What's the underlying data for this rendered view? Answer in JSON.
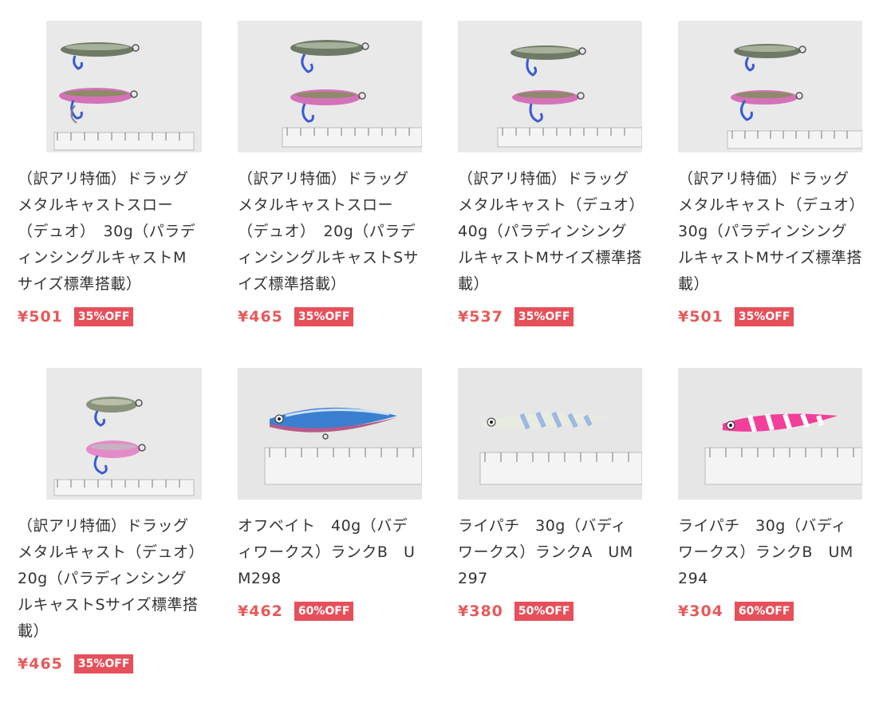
{
  "products": [
    {
      "title": "（訳アリ特価）ドラッグメタルキャストスロー（デュオ）　30g（パラディンシングルキャストMサイズ標準搭載）",
      "price": "¥501",
      "discount": "35%OFF",
      "image_icon": "twin-lure-photo-icon"
    },
    {
      "title": "（訳アリ特価）ドラッグメタルキャストスロー（デュオ）　20g（パラディンシングルキャストSサイズ標準搭載）",
      "price": "¥465",
      "discount": "35%OFF",
      "image_icon": "twin-lure-photo-icon"
    },
    {
      "title": "（訳アリ特価）ドラッグメタルキャスト（デュオ）　40g（パラディンシングルキャストMサイズ標準搭載）",
      "price": "¥537",
      "discount": "35%OFF",
      "image_icon": "twin-lure-photo-icon"
    },
    {
      "title": "（訳アリ特価）ドラッグメタルキャスト（デュオ）　30g（パラディンシングルキャストMサイズ標準搭載）",
      "price": "¥501",
      "discount": "35%OFF",
      "image_icon": "twin-lure-photo-icon"
    },
    {
      "title": "（訳アリ特価）ドラッグメタルキャスト（デュオ）　20g（パラディンシングルキャストSサイズ標準搭載）",
      "price": "¥465",
      "discount": "35%OFF",
      "image_icon": "twin-lure-photo-icon"
    },
    {
      "title": "オフベイト　40g（バディワークス）ランクB　UM298",
      "price": "¥462",
      "discount": "60%OFF",
      "image_icon": "blue-jig-photo-icon"
    },
    {
      "title": "ライパチ　30g（バディワークス）ランクA　UM297",
      "price": "¥380",
      "discount": "50%OFF",
      "image_icon": "glow-jig-photo-icon"
    },
    {
      "title": "ライパチ　30g（バディワークス）ランクB　UM294",
      "price": "¥304",
      "discount": "60%OFF",
      "image_icon": "pink-jig-photo-icon"
    }
  ],
  "colors": {
    "price": "#e65a5a",
    "badge_bg": "#e6505a",
    "text": "#333333"
  }
}
